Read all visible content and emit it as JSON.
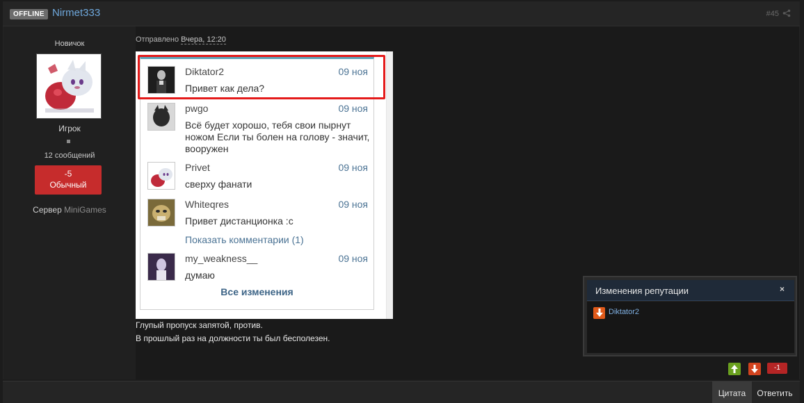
{
  "header": {
    "status_badge": "OFFLINE",
    "author_name": "Nirmet333",
    "post_number": "#45",
    "share_icon": "share-icon"
  },
  "author": {
    "rank_title": "Новичок",
    "group_name": "Игрок",
    "posts_count": "12 сообщений",
    "reputation_value": "-5",
    "reputation_label": "Обычный",
    "server_prefix": "Сервер",
    "server_name": "MiniGames"
  },
  "post": {
    "posted_prefix": "Отправлено",
    "posted_date": "Вчера, 12:20",
    "embedded_feed": {
      "items": [
        {
          "name": "Diktator2",
          "date": "09 ноя",
          "text": "Привет как дела?"
        },
        {
          "name": "pwgo",
          "date": "09 ноя",
          "text": "Всё будет хорошо, тебя свои пырнут ножом Если ты болен на голову - значит, вооружен"
        },
        {
          "name": "Privet",
          "date": "09 ноя",
          "text": "сверху фанати"
        },
        {
          "name": "Whiteqres",
          "date": "09 ноя",
          "text": "Привет дистанционка :с"
        },
        {
          "name": "my_weakness__",
          "date": "09 ноя",
          "text": "думаю"
        }
      ],
      "show_comments": "Показать комментарии (1)",
      "all_changes": "Все изменения"
    },
    "message_lines": [
      "Глупый пропуск запятой, против.",
      "В прошлый раз на должности ты был бесполезен."
    ]
  },
  "rep_popup": {
    "title": "Изменения репутации",
    "close": "×",
    "entry_name": "Diktator2"
  },
  "votes": {
    "score": "-1"
  },
  "footer": {
    "quote_label": "Цитата",
    "reply_label": "Ответить"
  },
  "colors": {
    "accent_link": "#6fa8dc",
    "rep_negative": "#c62c2c",
    "highlight": "#e41a1a",
    "vote_up": "#6aa01f",
    "vote_down": "#d1431e"
  }
}
